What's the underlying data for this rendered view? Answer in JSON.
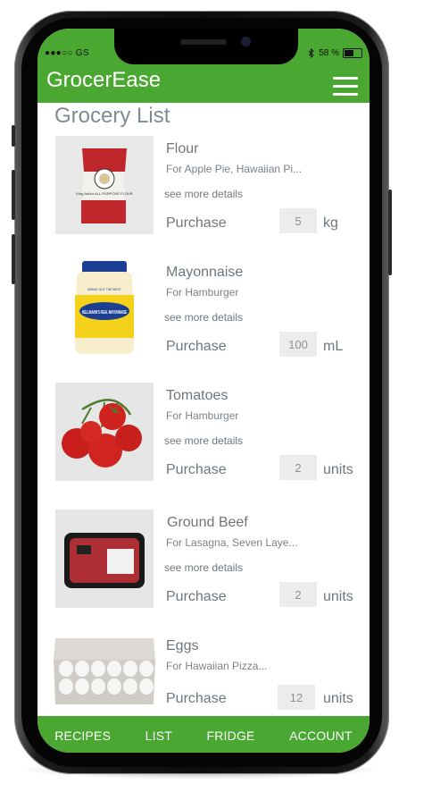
{
  "status": {
    "carrier": "●●●○○ GS",
    "battery": "58 %",
    "battery_level": 0.58
  },
  "header": {
    "title": "GrocerEase"
  },
  "page": {
    "title": "Grocery List"
  },
  "items": [
    {
      "name": "Flour",
      "for": "For Apple Pie, Hawaiian Pi...",
      "details": "see more details",
      "purchase": "Purchase",
      "qty": "5",
      "unit": "kg"
    },
    {
      "name": "Mayonnaise",
      "for": "For Hamburger",
      "details": "see more details",
      "purchase": "Purchase",
      "qty": "100",
      "unit": "mL"
    },
    {
      "name": "Tomatoes",
      "for": "For Hamburger",
      "details": "see more details",
      "purchase": "Purchase",
      "qty": "2",
      "unit": "units"
    },
    {
      "name": "Ground Beef",
      "for": "For Lasagna, Seven Laye...",
      "details": "see more details",
      "purchase": "Purchase",
      "qty": "2",
      "unit": "units"
    },
    {
      "name": "Eggs",
      "for": "For Hawaiian Pizza...",
      "details": "",
      "purchase": "Purchase",
      "qty": "12",
      "unit": "units"
    }
  ],
  "nav": {
    "recipes": "RECIPES",
    "list": "LIST",
    "fridge": "FRIDGE",
    "account": "ACCOUNT"
  },
  "colors": {
    "primary": "#4aa832",
    "text": "#6f777d"
  },
  "images": {
    "flour": "King Arthur ALL-PURPOSE FLOUR",
    "mayo": "HELLMANN'S REAL MAYONNAISE",
    "mayo_band": "BRING OUT THE BEST"
  }
}
